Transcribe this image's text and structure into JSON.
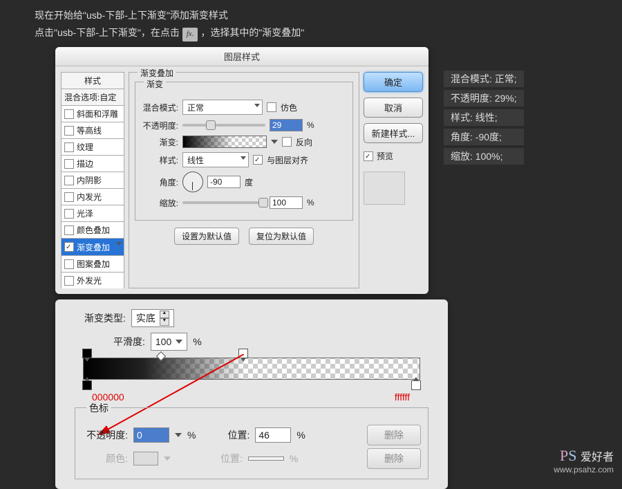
{
  "intro": {
    "line1": "现在开始给\"usb-下部-上下渐变\"添加渐变样式",
    "line2_a": "点击\"usb-下部-上下渐变\"，在点击 ",
    "fx": "fx.",
    "line2_b": " ，选择其中的\"渐变叠加\""
  },
  "dialog1": {
    "title": "图层样式",
    "styles_header": "样式",
    "blend_options": "混合选项:自定",
    "items": [
      {
        "label": "斜面和浮雕",
        "checked": false
      },
      {
        "label": "等高线",
        "checked": false
      },
      {
        "label": "纹理",
        "checked": false
      },
      {
        "label": "描边",
        "checked": false
      },
      {
        "label": "内阴影",
        "checked": false
      },
      {
        "label": "内发光",
        "checked": false
      },
      {
        "label": "光泽",
        "checked": false
      },
      {
        "label": "颜色叠加",
        "checked": false
      },
      {
        "label": "渐变叠加",
        "checked": true,
        "selected": true
      },
      {
        "label": "图案叠加",
        "checked": false
      },
      {
        "label": "外发光",
        "checked": false
      }
    ],
    "group_title": "渐变叠加",
    "inner_title": "渐变",
    "blend_mode_label": "混合模式:",
    "blend_mode_value": "正常",
    "dither_label": "仿色",
    "opacity_label": "不透明度:",
    "opacity_value": "29",
    "pct": "%",
    "gradient_label": "渐变:",
    "reverse_label": "反向",
    "style_label": "样式:",
    "style_value": "线性",
    "align_label": "与图层对齐",
    "angle_label": "角度:",
    "angle_value": "-90",
    "angle_unit": "度",
    "scale_label": "缩放:",
    "scale_value": "100",
    "btn_default": "设置为默认值",
    "btn_reset": "复位为默认值",
    "btn_ok": "确定",
    "btn_cancel": "取消",
    "btn_new": "新建样式...",
    "preview_label": "预览"
  },
  "annot": {
    "l1": "混合模式: 正常;",
    "l2": "不透明度: 29%;",
    "l3": "样式: 线性;",
    "l4": "角度: -90度;",
    "l5": "缩放: 100%;"
  },
  "dialog2": {
    "grad_type_label": "渐变类型:",
    "grad_type_value": "实底",
    "smooth_label": "平滑度:",
    "smooth_value": "100",
    "pct": "%",
    "color_left": "000000",
    "color_right": "ffffff",
    "sebiao_title": "色标",
    "opacity_label": "不透明度:",
    "opacity_value": "0",
    "position_label": "位置:",
    "position_value": "46",
    "delete_btn": "删除",
    "color_label": "颜色:",
    "position2_value": ""
  },
  "watermark": {
    "zh": "爱好者",
    "url": "www.psahz.com"
  }
}
